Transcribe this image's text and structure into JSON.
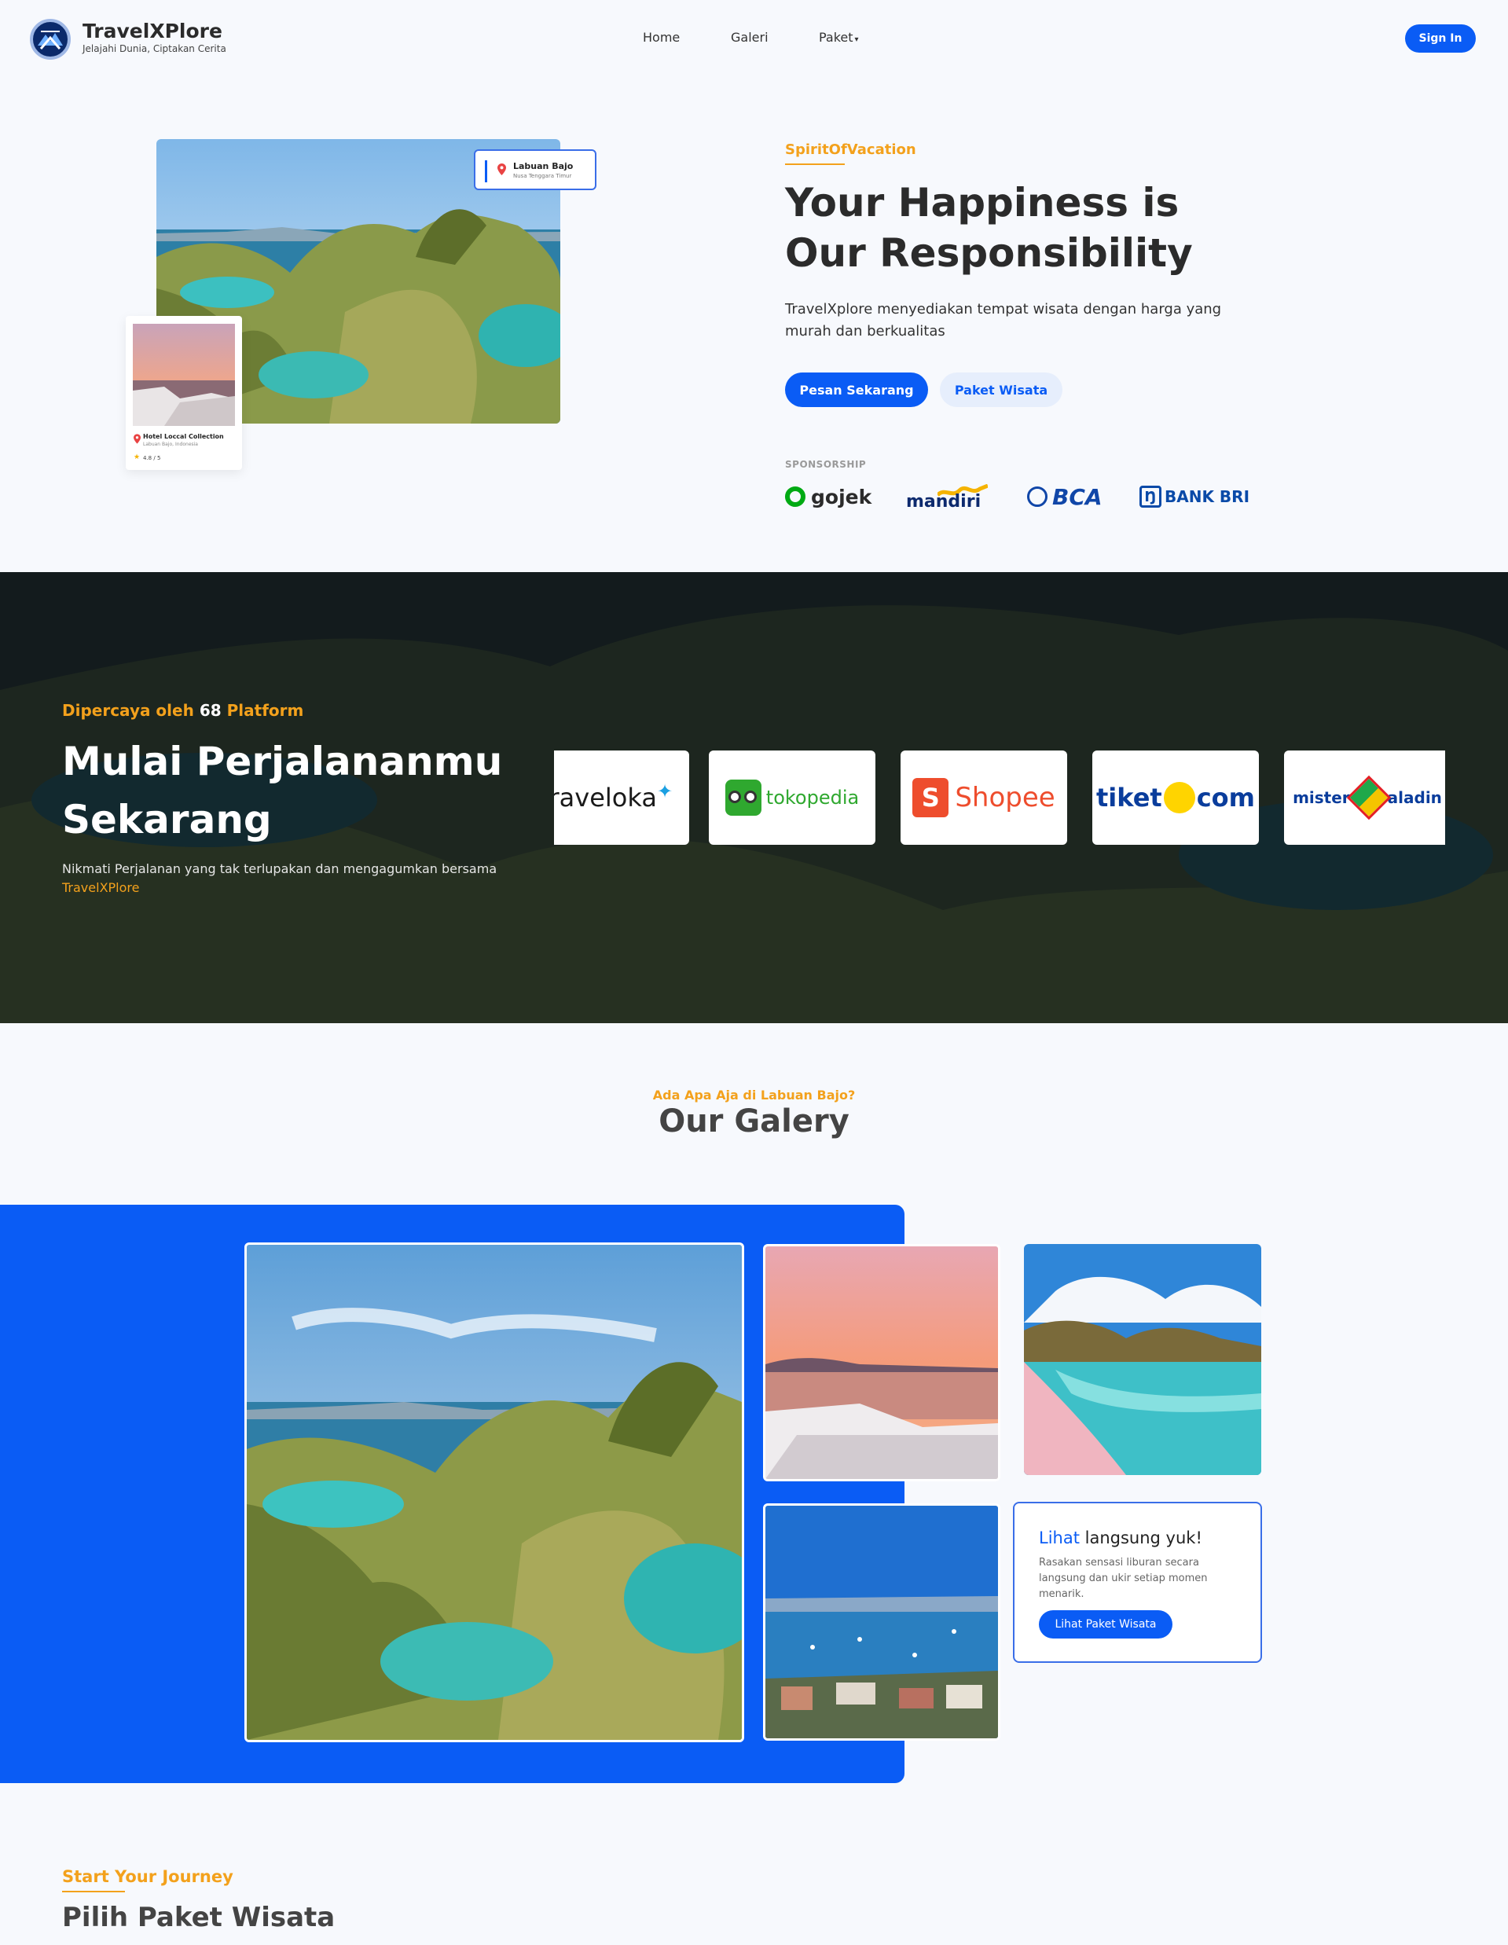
{
  "brand": {
    "name": "TravelXPlore",
    "tagline": "Jelajahi Dunia, Ciptakan Cerita"
  },
  "nav": {
    "items": [
      "Home",
      "Galeri",
      "Paket"
    ],
    "signin": "Sign In"
  },
  "hero": {
    "location_card": {
      "title": "Labuan Bajo",
      "subtitle": "Nusa Tenggara Timur"
    },
    "hotel_card": {
      "name": "Hotel Loccal Collection",
      "location": "Labuan Bajo, Indonesia",
      "rating": "4.8 / 5"
    },
    "eyebrow": "SpiritOfVacation",
    "title": "Your Happiness is Our Responsibility",
    "description": "TravelXplore menyediakan tempat wisata dengan harga yang murah dan berkualitas",
    "primary_button": "Pesan Sekarang",
    "secondary_button": "Paket Wisata",
    "sponsorship_label": "SPONSORSHIP",
    "sponsors": [
      "gojek",
      "mandiri",
      "BCA",
      "BANK BRI"
    ]
  },
  "platforms": {
    "trust_prefix": "Dipercaya oleh",
    "trust_count": "68",
    "trust_suffix": "Platform",
    "title": "Mulai Perjalananmu Sekarang",
    "desc_prefix": "Nikmati Perjalanan yang tak terlupakan dan mengagumkan bersama",
    "desc_brand": "TravelXPlore",
    "partners": [
      "traveloka",
      "tokopedia",
      "Shopee",
      "tiket",
      "com",
      "mister",
      "aladin"
    ]
  },
  "gallery": {
    "eyebrow": "Ada Apa Aja di Labuan Bajo?",
    "title": "Our Galery",
    "cta": {
      "title_highlight": "Lihat",
      "title_rest": "langsung yuk!",
      "description": "Rasakan sensasi liburan secara langsung dan ukir setiap momen menarik.",
      "button": "Lihat Paket Wisata"
    }
  },
  "packages": {
    "eyebrow": "Start Your Journey",
    "title": "Pilih Paket Wisata"
  },
  "colors": {
    "primary": "#0a5cf5",
    "accent": "#f3a11c",
    "dark_text": "#2b2b2b"
  }
}
